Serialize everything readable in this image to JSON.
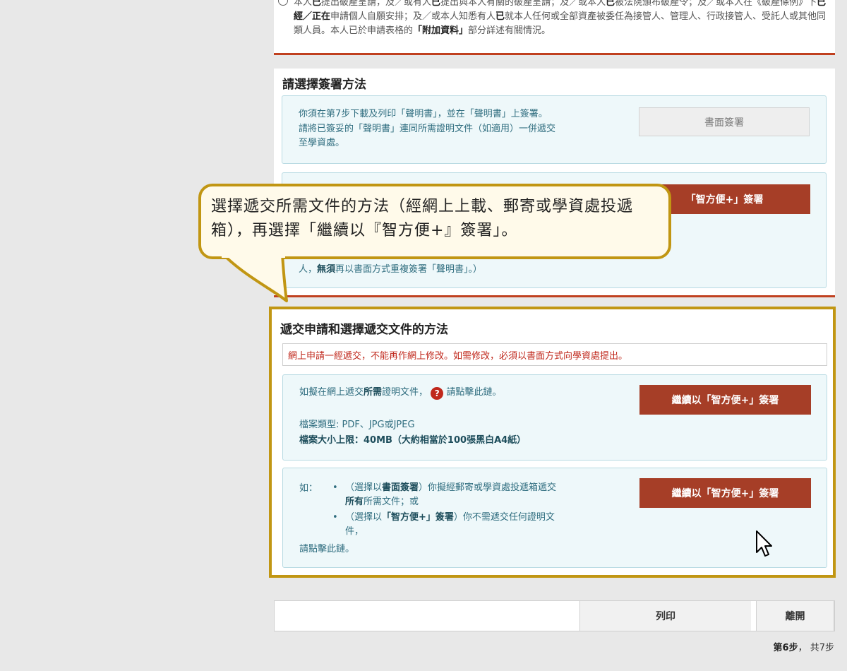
{
  "top_declaration": {
    "parts": [
      {
        "t": "本人",
        "b": false
      },
      {
        "t": "已",
        "b": true
      },
      {
        "t": "提出破產呈請，及／或有人",
        "b": false
      },
      {
        "t": "已",
        "b": true
      },
      {
        "t": "提出與本人有關的破產呈請；及／或本人",
        "b": false
      },
      {
        "t": "已",
        "b": true
      },
      {
        "t": "被法院頒布破產令；及／或本人在《破產條例》下",
        "b": false
      },
      {
        "t": "已經／正在",
        "b": true
      },
      {
        "t": "申請個人自願安排；及／或本人知悉有人",
        "b": false
      },
      {
        "t": "已",
        "b": true
      },
      {
        "t": "就本人任何或全部資產被委任為接管人、管理人、行政接管人、受託人或其他同類人員。本人已於申請表格的",
        "b": false
      },
      {
        "t": "「附加資料」",
        "b": true
      },
      {
        "t": "部分詳述有關情況。",
        "b": false
      }
    ]
  },
  "signing": {
    "title": "請選擇簽署方法",
    "paper_text_1": "你須在第7步下載及列印「聲明書」，並在「聲明書」上簽署。",
    "paper_text_2": "請將已簽妥的「聲明書」連同所需證明文件（如適用）一併遞交",
    "paper_text_3": "至學資處。",
    "paper_button": "書面簽署",
    "iamsmart_button": "「智方便+」簽署",
    "iamsmart_note_prefix": "人，",
    "iamsmart_note_bold": "無須",
    "iamsmart_note_suffix": "再以書面方式重複簽署「聲明書」。）"
  },
  "callout": {
    "text": "選擇遞交所需文件的方法（經網上上載、郵寄或學資處投遞箱），再選擇「繼續以『智方便+』簽署」。"
  },
  "submit": {
    "title": "遞交申請和選擇遞交文件的方法",
    "warning": "網上申請一經遞交，不能再作網上修改。如需修改，必須以書面方式向學資處提出。",
    "upload_prefix": "如擬在網上遞交",
    "upload_bold": "所需",
    "upload_mid": "證明文件，",
    "upload_suffix": "請點擊此鏈。",
    "file_types": "檔案類型: PDF、JPG或JPEG",
    "file_size": "檔案大小上限：40MB（大約相當於100張黑白A4紙）",
    "continue_button": "繼續以「智方便+」簽署",
    "other_label": "如：",
    "opt1_a": "（選擇以",
    "opt1_b": "書面簽署",
    "opt1_c": "）你擬經郵寄或學資處投遞箱遞交",
    "opt1_d": "所有",
    "opt1_e": "所需文件；或",
    "opt2_a": "（選擇以",
    "opt2_b": "「智方便+」簽署",
    "opt2_c": "）你不需遞交任何證明文",
    "opt2_d": "件，",
    "click_link": "請點擊此鏈。",
    "continue_button_2": "繼續以「智方便+」簽署"
  },
  "footer": {
    "print_button": "列印",
    "exit_button": "離開",
    "step_bold": "第6步",
    "step_rest": "， 共7步"
  },
  "icons": {
    "help": "question-icon",
    "cursor": "mouse-pointer-icon"
  }
}
